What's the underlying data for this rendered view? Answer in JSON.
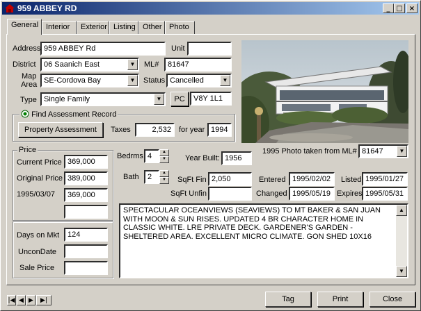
{
  "window": {
    "title": "959 ABBEY RD"
  },
  "titlebar_buttons": {
    "minimize": "_",
    "maximize": "□",
    "close": "×"
  },
  "tabs": [
    {
      "label": "General"
    },
    {
      "label": "Interior"
    },
    {
      "label": "Exterior"
    },
    {
      "label": "Listing"
    },
    {
      "label": "Other"
    },
    {
      "label": "Photo"
    }
  ],
  "general": {
    "address_label": "Address",
    "address": "959 ABBEY Rd",
    "unit_label": "Unit",
    "unit": "",
    "district_label": "District",
    "district": "06 Saanich East",
    "ml_label": "ML#",
    "ml": "81647",
    "maparea_label_1": "Map",
    "maparea_label_2": "Area",
    "maparea": "SE-Cordova Bay",
    "status_label": "Status",
    "status": "Cancelled",
    "type_label": "Type",
    "type": "Single Family",
    "pc_button": "PC",
    "postal": "V8Y 1L1"
  },
  "assessment": {
    "title": "Find Assessment Record",
    "button": "Property Assessment",
    "taxes_label": "Taxes",
    "taxes": "2,532",
    "year_label": "for year",
    "year": "1994"
  },
  "price": {
    "title": "Price",
    "current_label": "Current Price",
    "current": "369,000",
    "original_label": "Original Price",
    "original": "389,000",
    "date_label": "1995/03/07",
    "date_value": "369,000",
    "extra": ""
  },
  "dom": {
    "days_label": "Days on Mkt",
    "days": "124",
    "uncon_label": "UnconDate",
    "uncon": "",
    "sale_label": "Sale Price",
    "sale": ""
  },
  "details": {
    "bedrms_label": "Bedrms",
    "bedrms": "4",
    "bath_label": "Bath",
    "bath": "2",
    "yearbuilt_label": "Year Built:",
    "yearbuilt": "1956",
    "sqft_fin_label": "SqFt Fin",
    "sqft_fin": "2,050",
    "sqft_unfin_label": "SqFt Unfin",
    "sqft_unfin": "",
    "entered_label": "Entered",
    "entered": "1995/02/02",
    "changed_label": "Changed",
    "changed": "1995/05/19",
    "listed_label": "Listed",
    "listed": "1995/01/27",
    "expires_label": "Expires",
    "expires": "1995/05/31"
  },
  "photo": {
    "caption": "1995 Photo taken from ML#",
    "ml": "81647"
  },
  "remarks": "SPECTACULAR OCEANVIEWS (SEAVIEWS) TO MT BAKER & SAN JUAN WITH MOON & SUN RISES. UPDATED 4 BR CHARACTER HOME IN CLASSIC WHITE. LRE PRIVATE DECK. GARDENER'S GARDEN - SHELTERED AREA. EXCELLENT MICRO CLIMATE. GON SHED 10X16",
  "footer": {
    "nav_first": "|◀",
    "nav_prev": "◀",
    "nav_next": "▶",
    "nav_last": "▶|",
    "tag": "Tag",
    "print": "Print",
    "close": "Close"
  }
}
